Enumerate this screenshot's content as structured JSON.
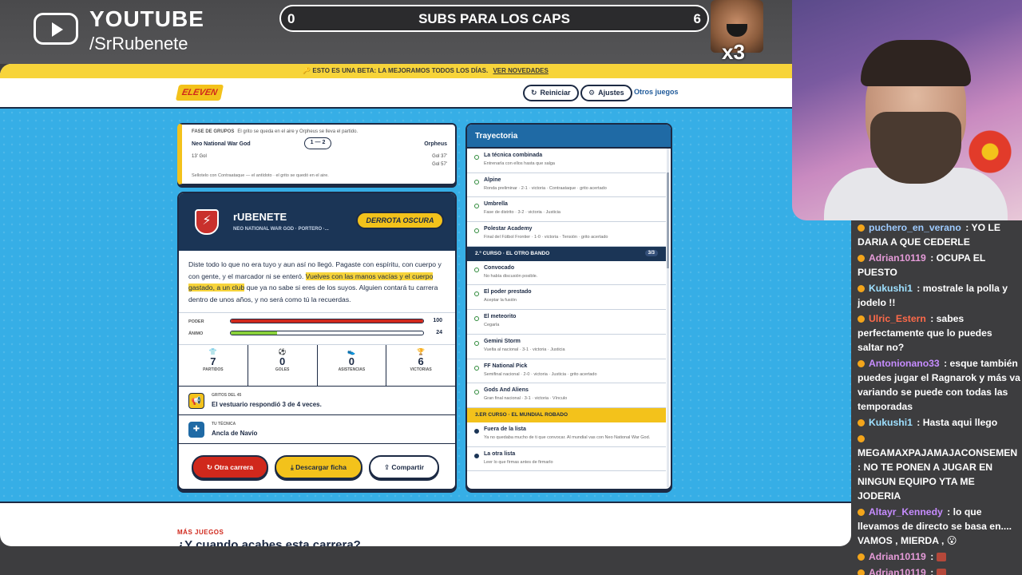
{
  "overlay": {
    "platform": "YOUTUBE",
    "handle": "/SrRubenete",
    "subs_goal": {
      "title": "SUBS PARA LOS CAPS",
      "left": "0",
      "right": "6",
      "progress": 0.0
    },
    "multiplier": "x3"
  },
  "site": {
    "beta_banner": "🔑 ESTO ES UNA BETA: LA MEJORAMOS TODOS LOS DÍAS.",
    "beta_link": "VER NOVEDADES",
    "logo_text": "ELEVEN",
    "nav": {
      "restart": "Reiniciar",
      "settings": "Ajustes",
      "other_games": "Otros juegos"
    },
    "match": {
      "phase": "FASE DE GRUPOS",
      "phase_note": "El grito se queda en el aire y Orpheus se lleva el partido.",
      "team_left": "Neo National War God",
      "team_right": "Orpheus",
      "score": "1 — 2",
      "goal_left": "13'  Gol",
      "goal_right_1": "Gol  37'",
      "goal_right_2": "Gol  57'",
      "footer": "Sellotelo con Contraataque — el antídoto · el grito se quedó en el aire."
    },
    "career": {
      "name": "rUBENETE",
      "meta": "NEO NATIONAL WAR GOD · PORTERO ·...",
      "result": "DERROTA OSCURA",
      "story_1": "Diste todo lo que no era tuyo y aun así no llegó. Pagaste con espíritu, con cuerpo y con gente, y el marcador ni se enteró. ",
      "story_highlight": "Vuelves con las manos vacías y el cuerpo gastado, a un club",
      "story_2": " que ya no sabe si eres de los suyos. Alguien contará tu carrera dentro de unos años, y no será como tú la recuerdas.",
      "power_label": "PODER",
      "power_value": "100",
      "power_fraction": 1.0,
      "mood_label": "ÁNIMO",
      "mood_value": "24",
      "mood_fraction": 0.24,
      "stats": [
        {
          "icon": "shirt-icon",
          "glyph": "👕",
          "num": "7",
          "label": "PARTIDOS"
        },
        {
          "icon": "ball-icon",
          "glyph": "⚽",
          "num": "0",
          "label": "GOLES"
        },
        {
          "icon": "shoe-icon",
          "glyph": "👟",
          "num": "0",
          "label": "ASISTENCIAS"
        },
        {
          "icon": "trophy-icon",
          "glyph": "🏆",
          "num": "6",
          "label": "VICTORIAS"
        }
      ],
      "shouts_title": "GRITOS DEL 45",
      "shouts_value": "El vestuario respondió 3 de 4 veces.",
      "technique_title": "TU TÉCNICA",
      "technique_value": "Ancla de Navío",
      "btn_restart": "Otra carrera",
      "btn_download": "Descargar ficha",
      "btn_share": "Compartir"
    },
    "trajectory": {
      "title": "Trayectoria",
      "items_a": [
        {
          "name": "La técnica combinada",
          "desc": "Entrenarla con ellos hasta que salga"
        },
        {
          "name": "Alpine",
          "desc": "Ronda preliminar · 2-1 · victoria · Contraataque · grito acertado"
        },
        {
          "name": "Umbrella",
          "desc": "Fase de distrito · 3-2 · victoria · Justicia"
        },
        {
          "name": "Polestar Academy",
          "desc": "Final del Fútbol Frontier · 1-0 · victoria · Tensión · grito acertado"
        }
      ],
      "section_2": "2.º CURSO · EL OTRO BANDO",
      "section_2_count": "3/3",
      "items_b": [
        {
          "name": "Convocado",
          "desc": "No había discusión posible."
        },
        {
          "name": "El poder prestado",
          "desc": "Aceptar la fusión"
        },
        {
          "name": "El meteorito",
          "desc": "Cegarla"
        },
        {
          "name": "Gemini Storm",
          "desc": "Vuelta al nacional · 3-1 · victoria · Justicia"
        },
        {
          "name": "FF National Pick",
          "desc": "Semifinal nacional · 2-0 · victoria · Justicia · grito acertado"
        },
        {
          "name": "Gods And Aliens",
          "desc": "Gran final nacional · 3-1 · victoria · Vínculo"
        }
      ],
      "section_3": "3.ER CURSO · EL MUNDIAL ROBADO",
      "items_c": [
        {
          "name": "Fuera de la lista",
          "desc": "Ya no quedaba mucho de ti que convocar. Al mundial vas con Neo National War God."
        },
        {
          "name": "La otra lista",
          "desc": "Leer lo que firmas antes de firmarlo"
        }
      ]
    },
    "more_games_label": "MÁS JUEGOS",
    "more_games_title": "¿Y cuando acabes esta carrera?"
  },
  "chat": [
    {
      "user": "puchero_en_verano",
      "color": "#9ecbff",
      "text": ": YO LE DARIA A QUE CEDERLE"
    },
    {
      "user": "Adrian10119",
      "color": "#e59bd8",
      "text": ": OCUPA EL PUESTO"
    },
    {
      "user": "Kukushi1",
      "color": "#9ee0ff",
      "text": ": mostrale la polla y jodelo !!"
    },
    {
      "user": "Ulric_Estern",
      "color": "#ff6a4a",
      "text": ": sabes perfectamente que lo puedes saltar no?"
    },
    {
      "user": "Antonionano33",
      "color": "#c68cff",
      "text": ": esque también puedes jugar el Ragnarok y más va variando se puede con todas las temporadas"
    },
    {
      "user": "Kukushi1",
      "color": "#9ee0ff",
      "text": ": Hasta aqui llego"
    },
    {
      "user": "MEGAMAXPAJAMAJACONSEMEN",
      "color": "#ffffff",
      "text": ": NO TE PONEN A JUGAR EN NINGUN EQUIPO YTA ME JODERIA"
    },
    {
      "user": "Altayr_Kennedy",
      "color": "#c68cff",
      "text": ": lo que llevamos de directo se basa en.... VAMOS , MIERDA , 😮"
    },
    {
      "user": "Adrian10119",
      "color": "#e59bd8",
      "text": ":"
    },
    {
      "user": "Adrian10119",
      "color": "#e59bd8",
      "text": ":"
    },
    {
      "user": "Adrian10119",
      "color": "#e59bd8",
      "text": ":"
    }
  ]
}
